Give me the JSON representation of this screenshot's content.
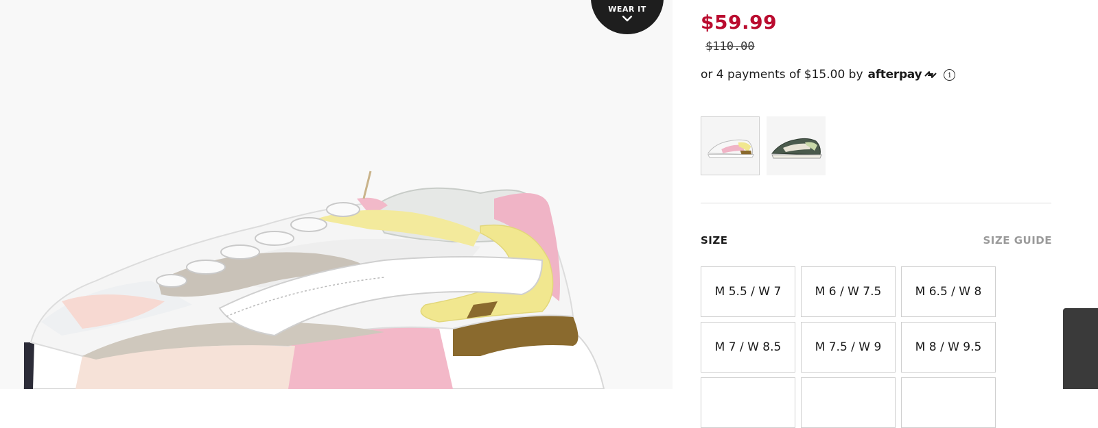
{
  "gallery": {
    "wear_it_label": "WEAR IT",
    "wear_it_icon": "chevron-down-icon"
  },
  "pricing": {
    "sale_price": "$59.99",
    "original_price": "$110.00",
    "sale_color": "#ba0c2f",
    "afterpay_text": "or 4 payments of $15.00 by",
    "afterpay_brand": "afterpay",
    "info_icon": "info-icon",
    "info_glyph": "i"
  },
  "swatches": [
    {
      "name": "pink-pastel-colorway",
      "selected": true
    },
    {
      "name": "green-colorway",
      "selected": false
    }
  ],
  "size": {
    "label": "SIZE",
    "guide_label": "SIZE GUIDE",
    "options": [
      "M 5.5 / W 7",
      "M 6 / W 7.5",
      "M 6.5 / W 8",
      "M 7 / W 8.5",
      "M 7.5 / W 9",
      "M 8 / W 9.5"
    ]
  }
}
